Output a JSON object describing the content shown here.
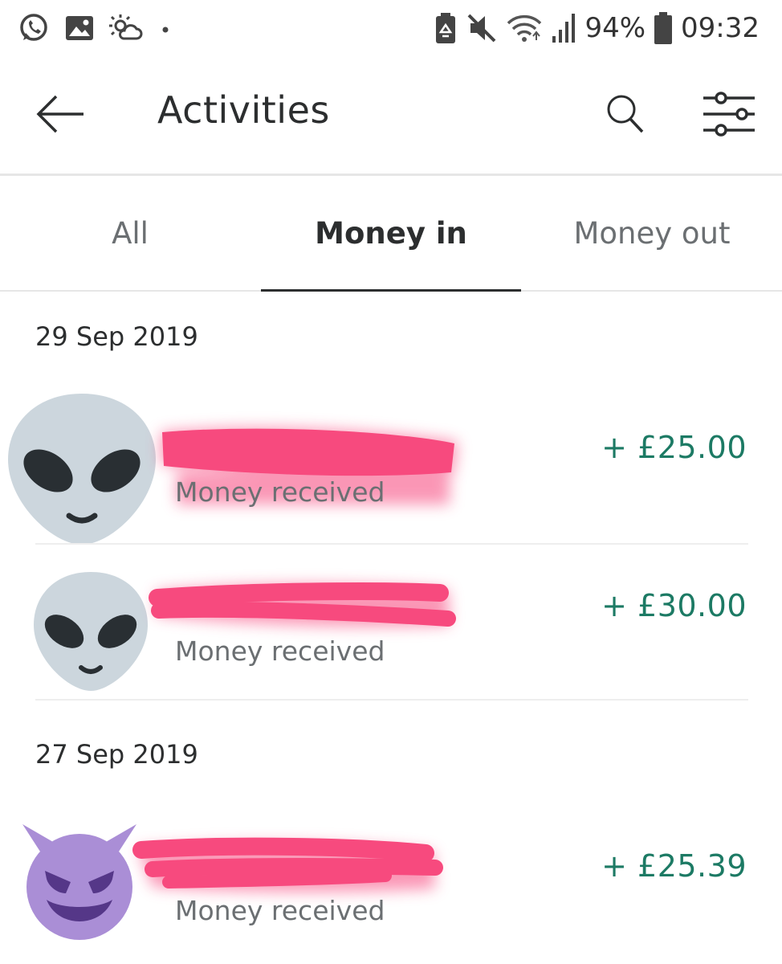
{
  "status_bar": {
    "battery_percent": "94%",
    "time": "09:32",
    "icons": [
      "whatsapp-icon",
      "gallery-icon",
      "weather-icon",
      "dot-icon",
      "battery-saver-icon",
      "mute-icon",
      "wifi-icon",
      "signal-icon",
      "battery-icon"
    ]
  },
  "header": {
    "title": "Activities",
    "icons": [
      "back-arrow-icon",
      "search-icon",
      "filter-sliders-icon"
    ]
  },
  "tabs": [
    {
      "label": "All",
      "active": false
    },
    {
      "label": "Money in",
      "active": true
    },
    {
      "label": "Money out",
      "active": false
    }
  ],
  "groups": [
    {
      "date": "29 Sep 2019",
      "transactions": [
        {
          "avatar": "alien-emoji",
          "description": "Money received",
          "amount": "+ £25.00"
        },
        {
          "avatar": "alien-emoji",
          "description": "Money received",
          "amount": "+ £30.00"
        }
      ]
    },
    {
      "date": "27 Sep 2019",
      "transactions": [
        {
          "avatar": "smiling-devil-emoji",
          "description": "Money received",
          "amount": "+ £25.39"
        }
      ]
    }
  ],
  "colors": {
    "amount": "#1c7a64",
    "redaction": "#f7437a",
    "alien": "#ccd6dd",
    "devil": "#aa8ed6"
  }
}
